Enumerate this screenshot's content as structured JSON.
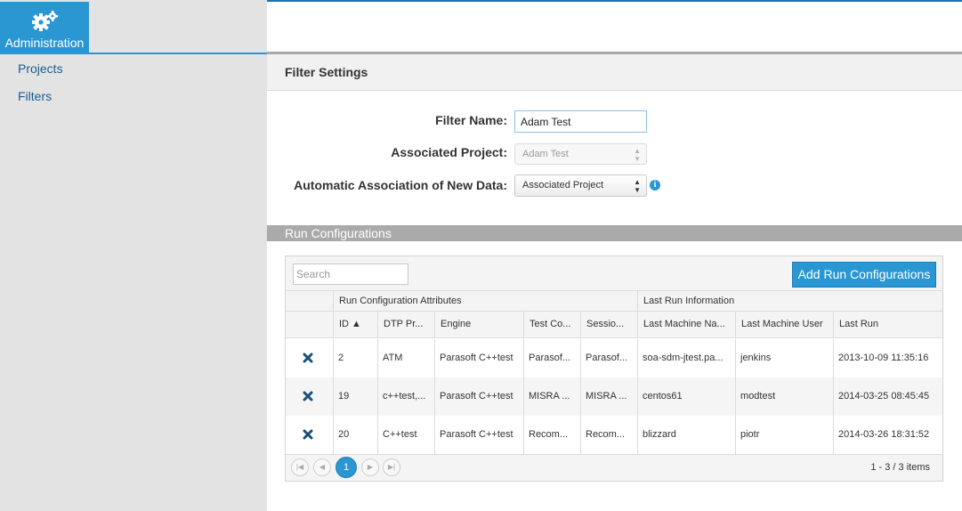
{
  "sidebar": {
    "admin_label": "Administration",
    "links": [
      "Projects",
      "Filters"
    ]
  },
  "filter_settings": {
    "title": "Filter Settings",
    "filter_name_label": "Filter Name:",
    "filter_name_value": "Adam Test",
    "associated_project_label": "Associated Project:",
    "associated_project_value": "Adam Test",
    "auto_assoc_label": "Automatic Association of New Data:",
    "auto_assoc_value": "Associated Project"
  },
  "run_configurations": {
    "title": "Run Configurations",
    "search_placeholder": "Search",
    "add_button": "Add Run Configurations",
    "groups": [
      "Run Configuration Attributes",
      "Last Run Information"
    ],
    "columns": [
      "ID ▲",
      "DTP Pr...",
      "Engine",
      "Test Co...",
      "Sessio...",
      "Last Machine Na...",
      "Last Machine User",
      "Last Run"
    ],
    "rows": [
      [
        "2",
        "ATM",
        "Parasoft C++test",
        "Parasof...",
        "Parasof...",
        "soa-sdm-jtest.pa...",
        "jenkins",
        "2013-10-09 11:35:16"
      ],
      [
        "19",
        "c++test,...",
        "Parasoft C++test",
        "MISRA ...",
        "MISRA ...",
        "centos61",
        "modtest",
        "2014-03-25 08:45:45"
      ],
      [
        "20",
        "C++test",
        "Parasoft C++test",
        "Recom...",
        "Recom...",
        "blizzard",
        "piotr",
        "2014-03-26 18:31:52"
      ]
    ],
    "pager": {
      "current_page": "1",
      "info": "1 - 3 / 3 items"
    }
  },
  "colors": {
    "accent": "#2a97d2",
    "sidebar_bg": "#e3e3e3",
    "delete_icon": "#1a4f7a"
  }
}
